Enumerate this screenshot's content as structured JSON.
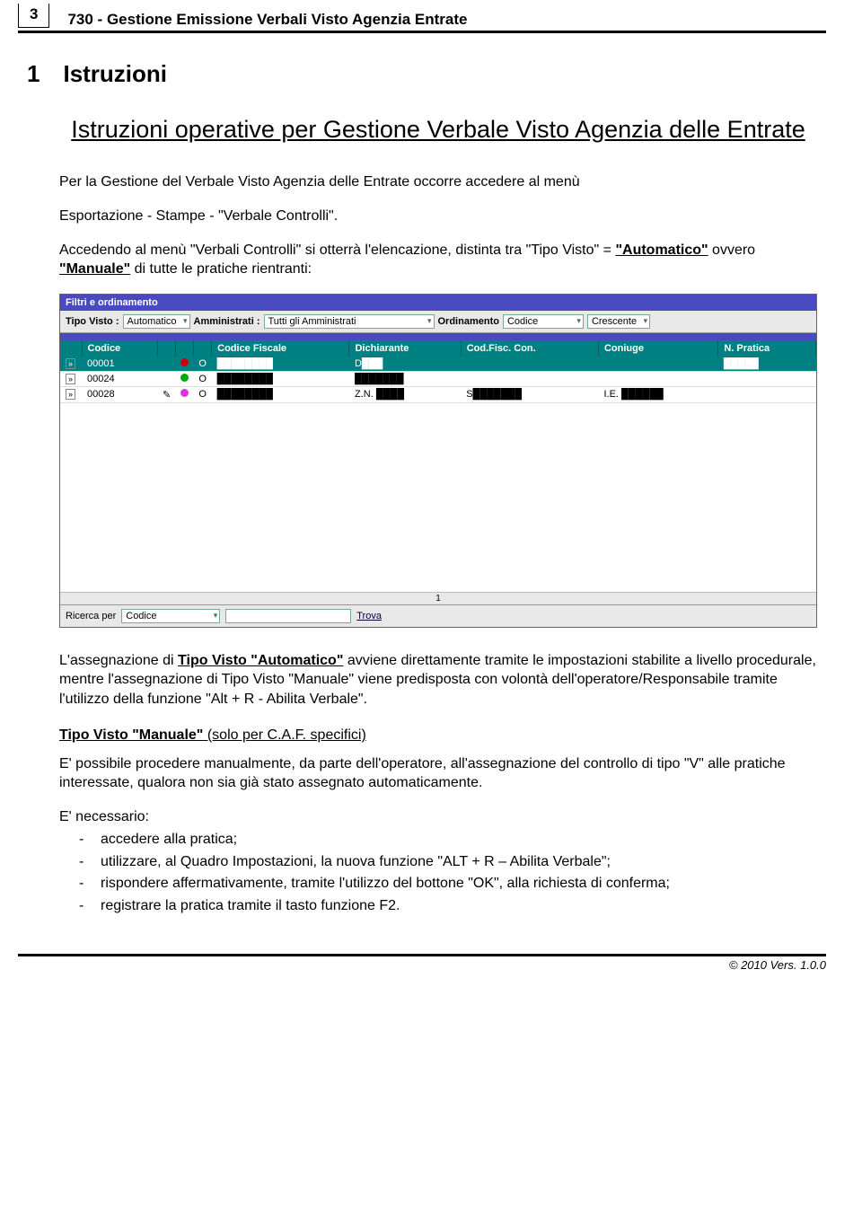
{
  "header": {
    "page_number": "3",
    "title": "730 - Gestione Emissione Verbali Visto Agenzia Entrate"
  },
  "section": {
    "number": "1",
    "name": "Istruzioni"
  },
  "main_title": "Istruzioni operative per Gestione Verbale Visto Agenzia delle Entrate",
  "para1": "Per la Gestione del Verbale Visto Agenzia delle Entrate occorre accedere al menù",
  "para2": "Esportazione - Stampe - \"Verbale Controlli\".",
  "para3_pre": "Accedendo al menù \"Verbali Controlli\" si otterrà l'elencazione, distinta tra \"Tipo Visto\" = ",
  "para3_b1": "\"Automatico\"",
  "para3_mid": " ovvero ",
  "para3_b2": "\"Manuale\"",
  "para3_post": " di tutte le pratiche rientranti:",
  "shot": {
    "bar": "Filtri e ordinamento",
    "labels": {
      "tipo_visto": "Tipo Visto :",
      "amministrati": "Amministrati :",
      "ordinamento": "Ordinamento",
      "crescente": "Crescente",
      "ricerca": "Ricerca per",
      "trova": "Trova"
    },
    "selects": {
      "tipo_visto": "Automatico",
      "amministrati": "Tutti gli Amministrati",
      "ordinamento": "Codice",
      "crescente": "Crescente",
      "ricerca": "Codice"
    },
    "cols": [
      "",
      "Codice",
      "",
      "",
      "",
      "Codice Fiscale",
      "Dichiarante",
      "Cod.Fisc. Con.",
      "Coniuge",
      "N. Pratica"
    ],
    "rows": [
      {
        "codice": "00001",
        "cf": "████████",
        "dich": "D███",
        "cfc": "",
        "con": "",
        "np": "█████",
        "dot": "red"
      },
      {
        "codice": "00024",
        "cf": "████████",
        "dich": "███████",
        "cfc": "",
        "con": "",
        "np": "",
        "dot": "green"
      },
      {
        "codice": "00028",
        "cf": "████████",
        "dich": "Z.N. ████",
        "cfc": "S███████",
        "con": "I.E. ██████",
        "np": "",
        "dot": "pink"
      }
    ],
    "page": "1"
  },
  "para4_pre": "L'assegnazione di ",
  "para4_b": "Tipo Visto \"Automatico\"",
  "para4_post": " avviene direttamente tramite le impostazioni stabilite a livello procedurale, mentre l'assegnazione di Tipo Visto \"Manuale\" viene predisposta con volontà dell'operatore/Responsabile tramite l'utilizzo della funzione \"Alt + R - Abilita Verbale\".",
  "subhead": {
    "t1": "Tipo Visto \"Manuale\"",
    "t2": " (solo per C.A.F. specifici)"
  },
  "para5": "E' possibile procedere manualmente, da parte dell'operatore, all'assegnazione del controllo di tipo \"V\" alle pratiche interessate, qualora non sia già stato assegnato automaticamente.",
  "para6": "E' necessario:",
  "bullets": [
    "accedere alla pratica;",
    "utilizzare, al Quadro Impostazioni, la nuova funzione \"ALT + R – Abilita Verbale\";",
    "rispondere affermativamente, tramite l'utilizzo del bottone \"OK\", alla richiesta di conferma;",
    "registrare la pratica tramite il tasto funzione F2."
  ],
  "footer": "© 2010 Vers. 1.0.0"
}
